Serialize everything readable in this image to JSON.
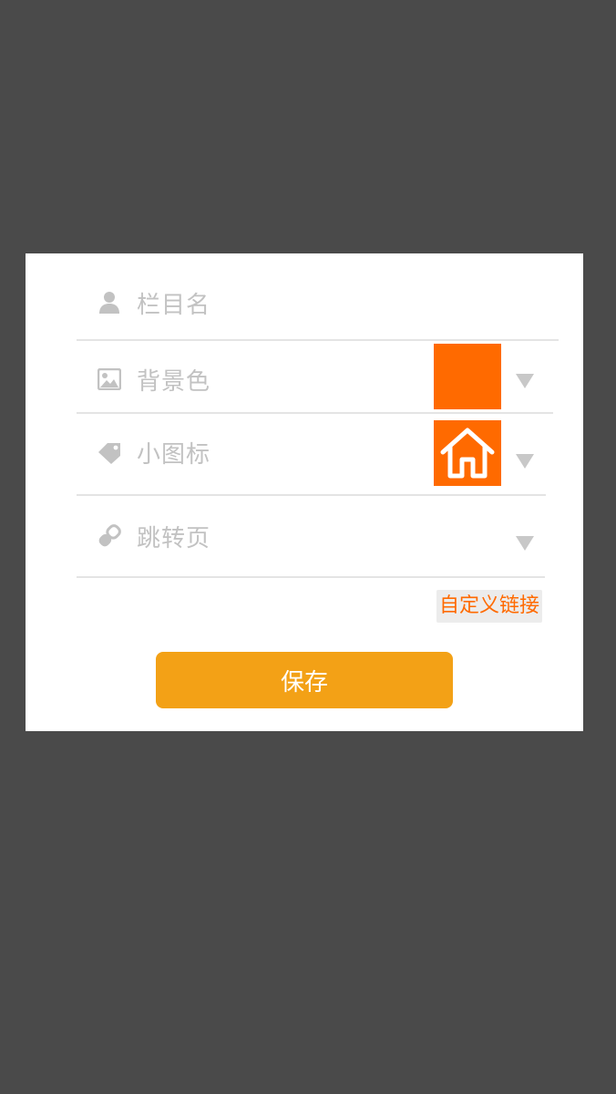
{
  "form": {
    "name_placeholder": "栏目名",
    "background_label": "背景色",
    "background_color": "#ff6a00",
    "icon_label": "小图标",
    "selected_icon": "home-icon",
    "page_label": "跳转页"
  },
  "actions": {
    "custom_link_label": "自定义链接",
    "save_label": "保存"
  },
  "colors": {
    "accent": "#ff6a00",
    "button": "#f3a116",
    "overlay": "#4a4a4a",
    "placeholder": "#c2c2c2"
  },
  "icons": {
    "name_row": "user-icon",
    "background_row": "image-icon",
    "icon_row": "tag-icon",
    "page_row": "link-icon",
    "dropdown": "caret-down-icon"
  }
}
